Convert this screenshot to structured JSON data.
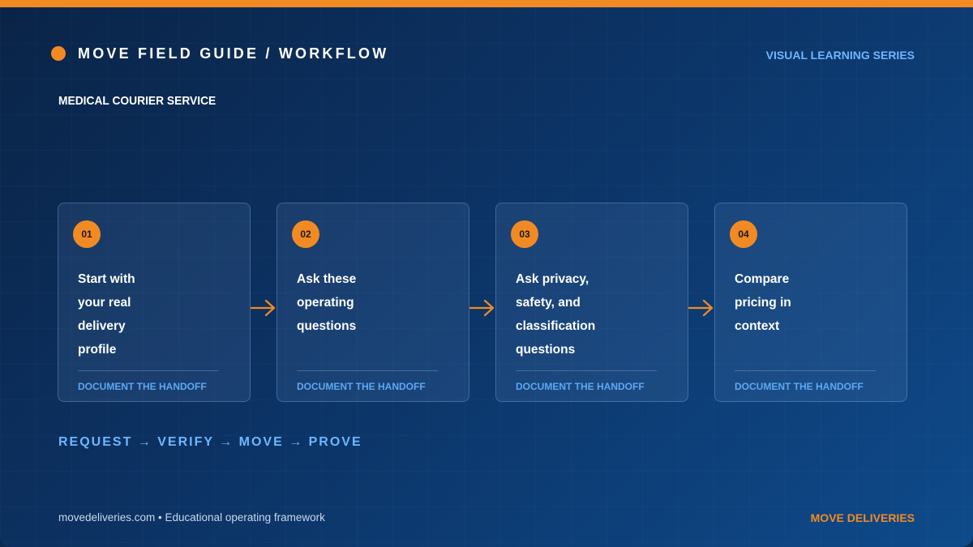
{
  "header": {
    "title": "MOVE FIELD GUIDE / WORKFLOW",
    "series": "VISUAL LEARNING SERIES",
    "subtitle": "MEDICAL COURIER SERVICE"
  },
  "steps": [
    {
      "number": "01",
      "lines": [
        "Start with",
        "your real",
        "delivery",
        "profile"
      ],
      "footer": "DOCUMENT THE HANDOFF"
    },
    {
      "number": "02",
      "lines": [
        "Ask these",
        "operating",
        "questions"
      ],
      "footer": "DOCUMENT THE HANDOFF"
    },
    {
      "number": "03",
      "lines": [
        "Ask privacy,",
        "safety, and",
        "classification",
        "questions"
      ],
      "footer": "DOCUMENT THE HANDOFF"
    },
    {
      "number": "04",
      "lines": [
        "Compare",
        "pricing in",
        "context"
      ],
      "footer": "DOCUMENT THE HANDOFF"
    }
  ],
  "flow": "REQUEST → VERIFY → MOVE → PROVE",
  "footer": {
    "left": "movedeliveries.com • Educational operating framework",
    "right": "MOVE DELIVERIES"
  },
  "colors": {
    "accent": "#f28a24",
    "link": "#6fb6ff",
    "background": "#0c3365"
  },
  "icons": {
    "connector": "arrow-right-icon",
    "bullet": "orange-dot-icon"
  }
}
